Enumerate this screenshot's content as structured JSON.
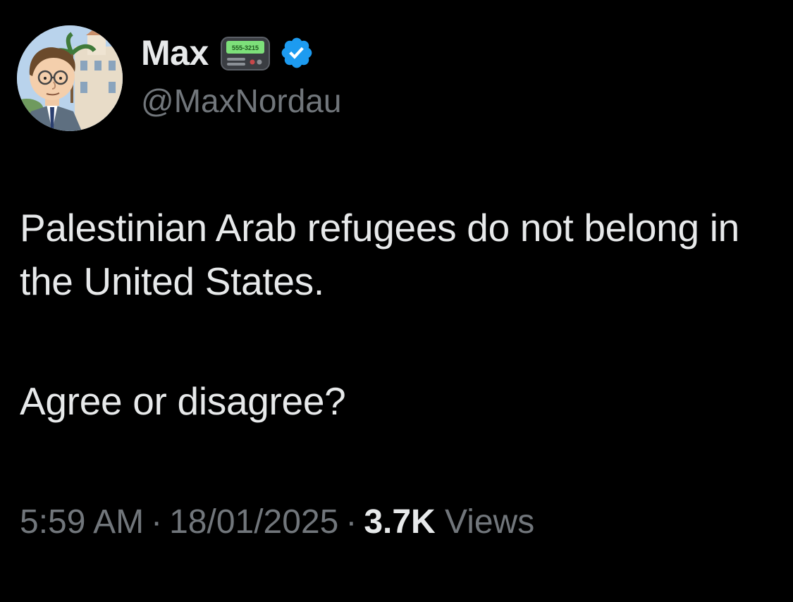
{
  "author": {
    "display_name": "Max",
    "handle": "@MaxNordau",
    "pager_number": "555-3215",
    "badge": "verified-icon",
    "verified_color": "#1d9bf0"
  },
  "tweet": {
    "line1": "Palestinian Arab refugees do not belong in the United States.",
    "line2": "Agree or disagree?"
  },
  "meta": {
    "time": "5:59 AM",
    "separator": "·",
    "date": "18/01/2025",
    "views_count": "3.7K",
    "views_label": "Views"
  },
  "colors": {
    "background": "#000000",
    "primary_text": "#e7e9ea",
    "secondary_text": "#71767b"
  }
}
